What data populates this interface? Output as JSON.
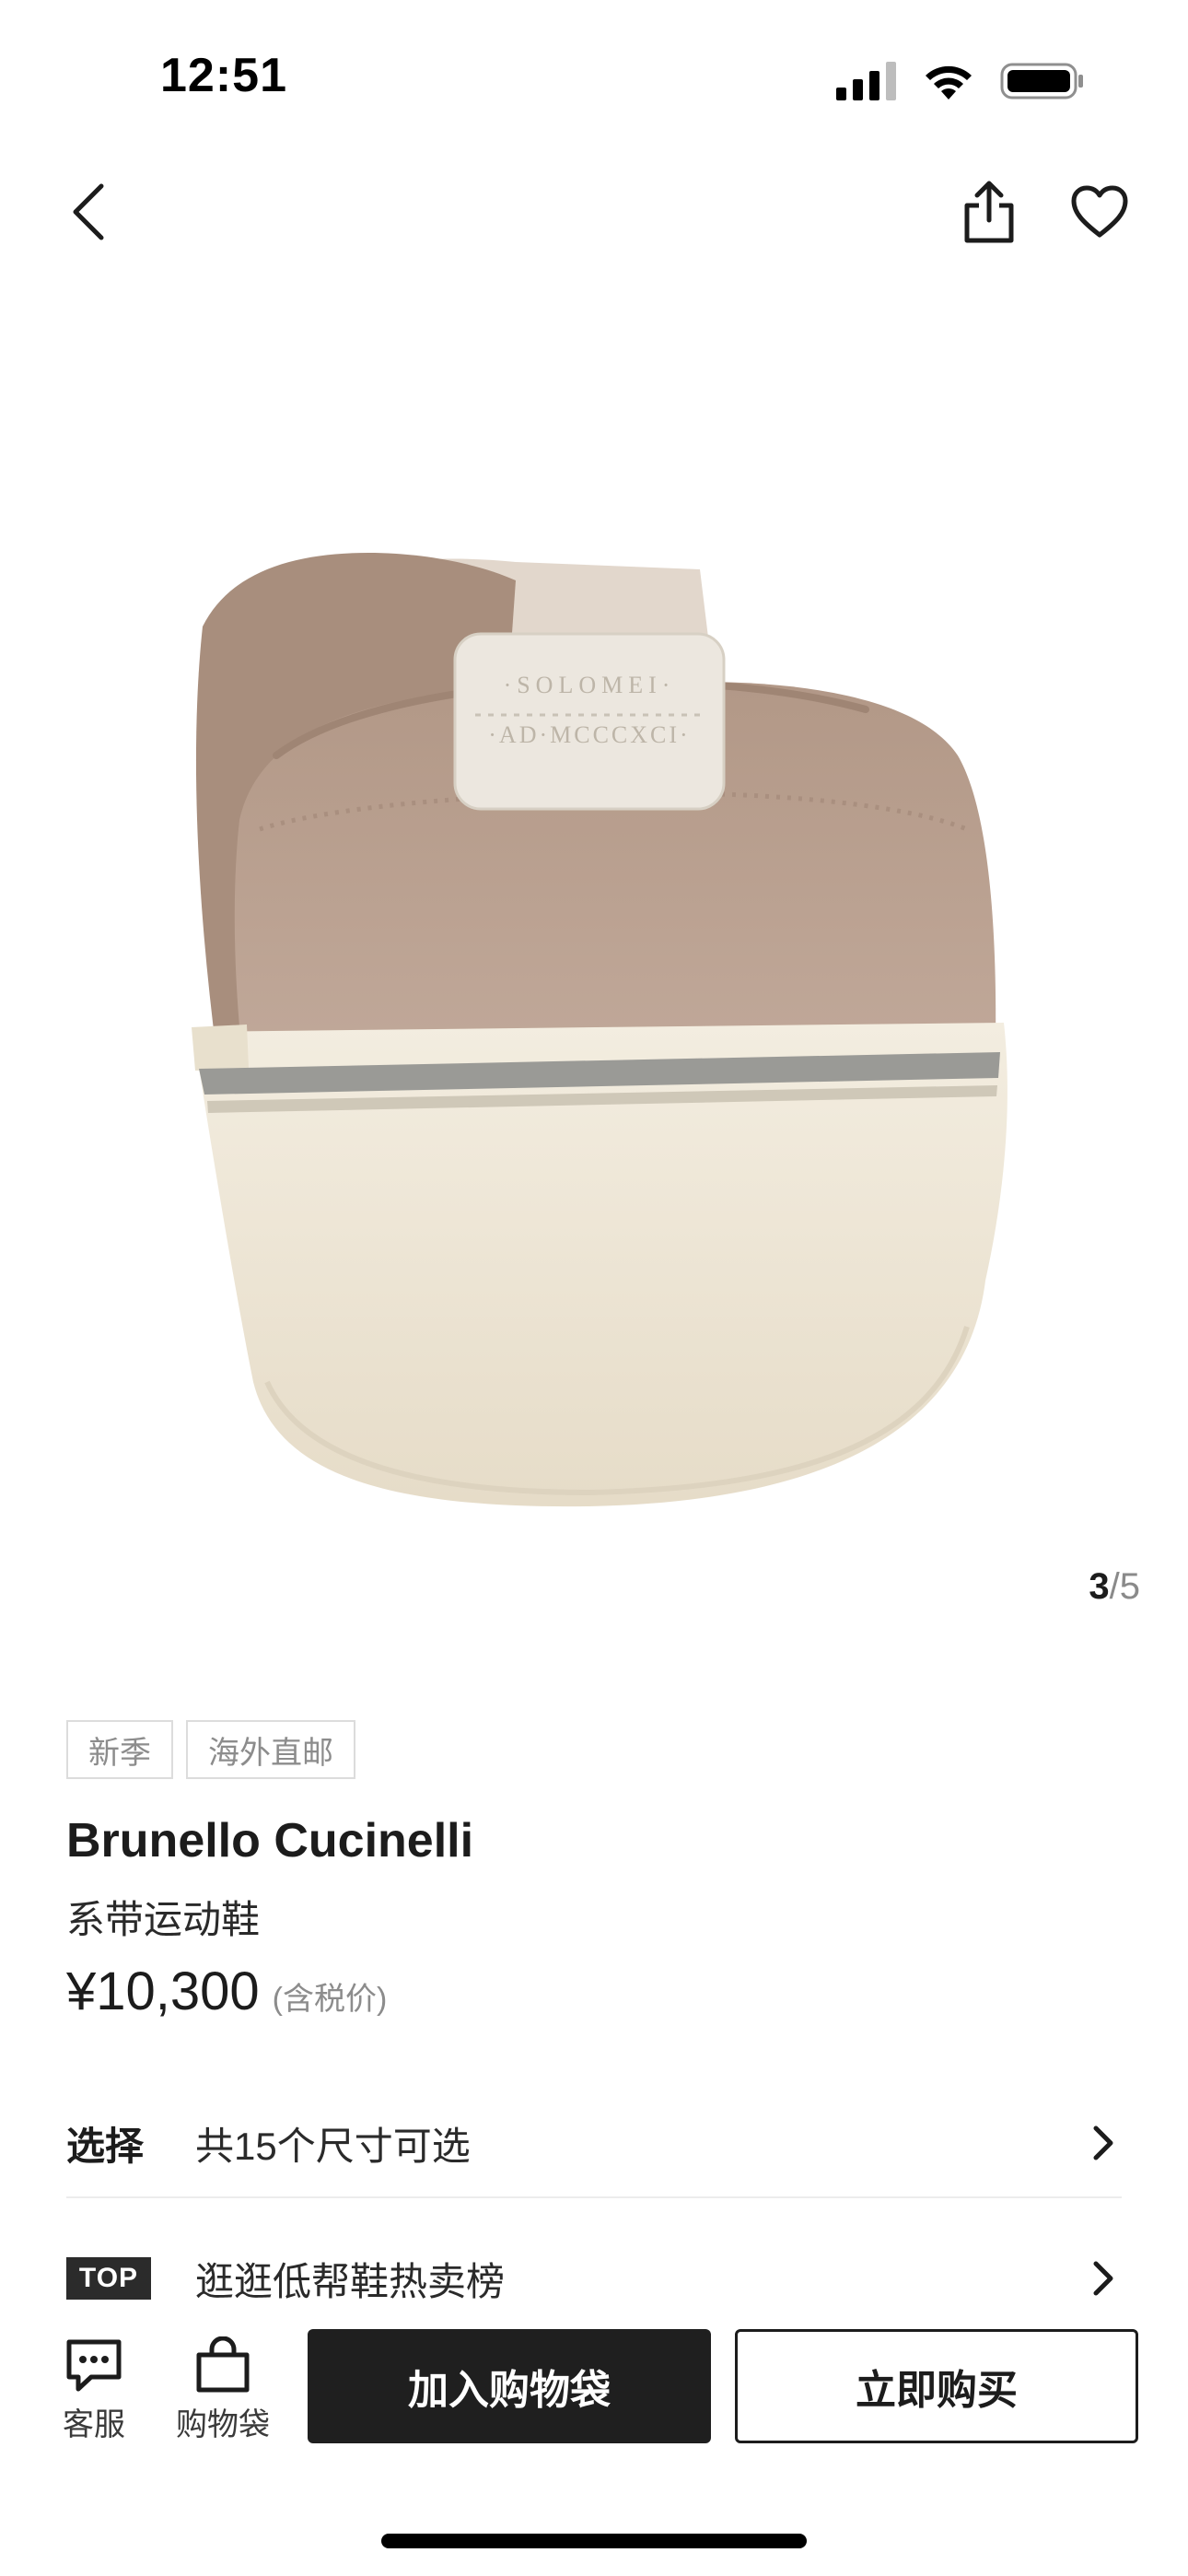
{
  "status_bar": {
    "time": "12:51",
    "icons": [
      "signal-icon",
      "wifi-icon",
      "battery-icon"
    ]
  },
  "nav": {
    "icons": [
      "back-icon",
      "share-icon",
      "heart-icon"
    ]
  },
  "product_image": {
    "heel_tab_line1": "·SOLOMEI·",
    "heel_tab_line2": "·AD·MCCCXCI·"
  },
  "pager": {
    "current": "3",
    "separator": "/",
    "total": "5"
  },
  "tags": [
    "新季",
    "海外直邮"
  ],
  "product": {
    "brand": "Brunello Cucinelli",
    "name": "系带运动鞋",
    "price": "¥10,300",
    "price_note": "(含税价)"
  },
  "size_row": {
    "label": "选择",
    "text": "共15个尺寸可选"
  },
  "ranking_row": {
    "badge": "TOP",
    "text": "逛逛低帮鞋热卖榜"
  },
  "bottom_bar": {
    "service_label": "客服",
    "bag_label": "购物袋",
    "add_to_bag": "加入购物袋",
    "buy_now": "立即购买"
  },
  "colors": {
    "primary_dark": "#1f1f1f",
    "suede": "#b59c8a",
    "sole": "#efe8d8",
    "sole_stripe": "#9a9a96"
  }
}
